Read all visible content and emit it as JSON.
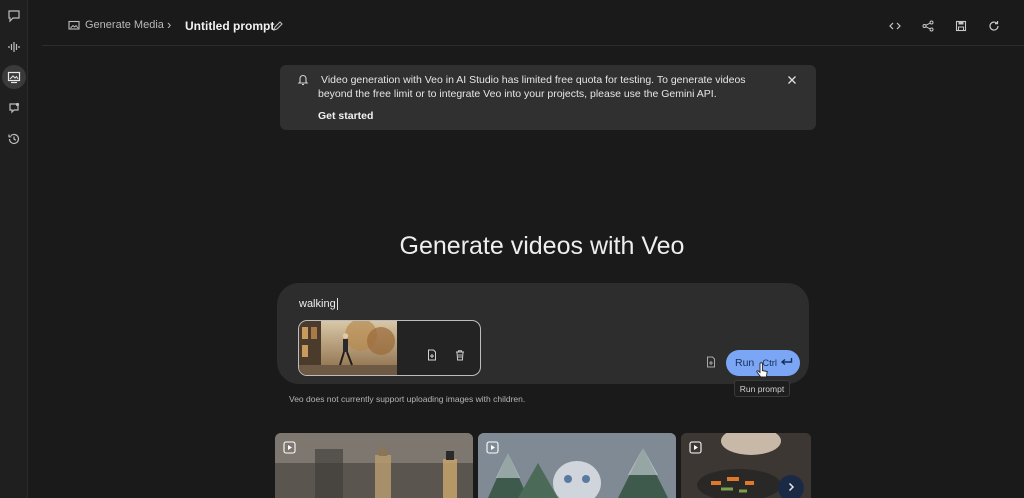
{
  "rail": {
    "items": [
      {
        "name": "chat-icon"
      },
      {
        "name": "audio-icon"
      },
      {
        "name": "media-icon",
        "active": true
      },
      {
        "name": "stream-icon"
      },
      {
        "name": "history-icon"
      }
    ]
  },
  "header": {
    "breadcrumb_link": "Generate Media",
    "breadcrumb_separator": "›",
    "title": "Untitled prompt",
    "actions": [
      "code-icon",
      "share-icon",
      "save-icon",
      "refresh-icon"
    ]
  },
  "banner": {
    "text": "Video generation with Veo in AI Studio has limited free quota for testing. To generate videos beyond the free limit or to integrate Veo into your projects, please use the Gemini API.",
    "link": "Get started"
  },
  "main": {
    "heading": "Generate videos with Veo"
  },
  "prompt": {
    "value": "walking",
    "run_label": "Run",
    "run_shortcut": "Ctrl",
    "tooltip": "Run prompt",
    "note": "Veo does not currently support uploading images with children."
  },
  "colors": {
    "accent": "#7ba6f5",
    "background": "#1a1a1a",
    "surface": "#2d2d2d",
    "banner": "#303030"
  }
}
